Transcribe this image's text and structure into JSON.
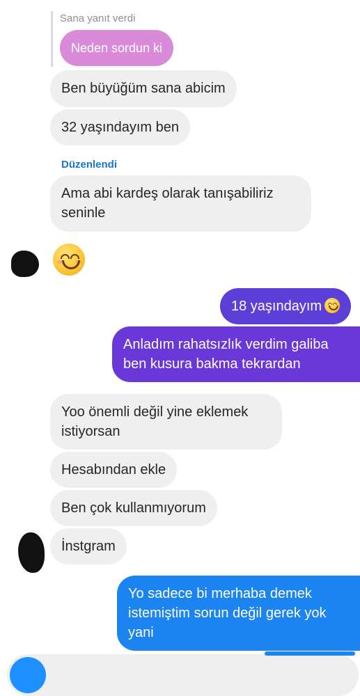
{
  "reply": {
    "label": "Sana yanıt verdi",
    "quoted_text": "Neden sordun ki"
  },
  "edited_label": "Düzenlendi",
  "messages": [
    {
      "side": "in",
      "text": "Ben büyüğüm sana abicim"
    },
    {
      "side": "in",
      "text": "32 yaşındayım ben"
    },
    {
      "side": "in",
      "text": "Ama abi kardeş olarak tanışabiliriz seninle"
    },
    {
      "side": "in",
      "emoji": "smiling-face-emoji"
    },
    {
      "side": "out",
      "text": "18 yaşındayım"
    },
    {
      "side": "out",
      "text": "Anladım rahatsızlık verdim galiba ben kusura bakma tekrardan"
    },
    {
      "side": "in",
      "text": "Yoo önemli değil yine eklemek istiyorsan"
    },
    {
      "side": "in",
      "text": "Hesabından ekle"
    },
    {
      "side": "in",
      "text": "Ben çok kullanmıyorum"
    },
    {
      "side": "in",
      "text": "İnstgram"
    },
    {
      "side": "out",
      "text": "Yo sadece bi merhaba demek istemiştim sorun değil gerek yok yani"
    }
  ],
  "colors": {
    "incoming_bubble": "#efefef",
    "reply_bubble": "#d98ad9",
    "outgoing_purple": "#5b3fd6",
    "outgoing_violet": "#6a37d8",
    "outgoing_blue": "#1b84f0",
    "edited_label": "#1877d4"
  }
}
